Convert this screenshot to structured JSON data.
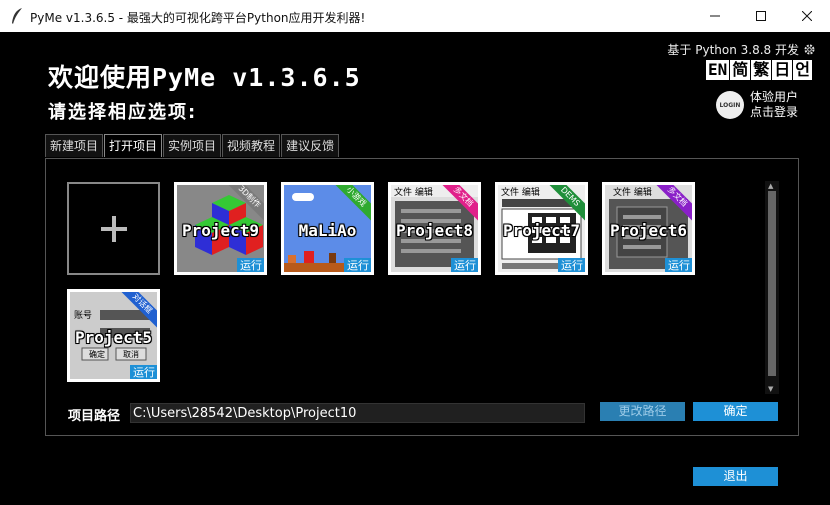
{
  "window": {
    "title": "PyMe v1.3.6.5 -  最强大的可视化跨平台Python应用开发利器!"
  },
  "header": {
    "python_info": "基于 Python 3.8.8 开发",
    "langs": [
      "EN",
      "简",
      "繁",
      "日",
      "언"
    ],
    "login_icon_text": "LOGIN",
    "login_line1": "体验用户",
    "login_line2": "点击登录",
    "welcome": "欢迎使用PyMe v1.3.6.5",
    "subtitle": "请选择相应选项:"
  },
  "tabs": [
    "新建项目",
    "打开项目",
    "实例项目",
    "视频教程",
    "建议反馈"
  ],
  "active_tab": "打开项目",
  "projects": [
    {
      "name": "Project9",
      "ribbon": "3D制作",
      "ribbon_color": "#7a7a7a",
      "run": "运行"
    },
    {
      "name": "MaLiAo",
      "ribbon": "小游戏",
      "ribbon_color": "#2faa2f",
      "run": "运行"
    },
    {
      "name": "Project8",
      "ribbon": "多文档",
      "ribbon_color": "#e0208a",
      "run": "运行"
    },
    {
      "name": "Project7",
      "ribbon": "DEMS",
      "ribbon_color": "#1f8f3a",
      "run": "运行"
    },
    {
      "name": "Project6",
      "ribbon": "多文档",
      "ribbon_color": "#8a20c8",
      "run": "运行"
    },
    {
      "name": "Project5",
      "ribbon": "对话框",
      "ribbon_color": "#2060d0",
      "run": "运行"
    }
  ],
  "thumb_text": {
    "menu": "文件 编辑",
    "account": "账号",
    "confirm": "确定",
    "cancel": "取消"
  },
  "path": {
    "label": "项目路径",
    "value": "C:\\Users\\28542\\Desktop\\Project10",
    "change_button": "更改路径",
    "confirm_button": "确定"
  },
  "exit_button": "退出"
}
